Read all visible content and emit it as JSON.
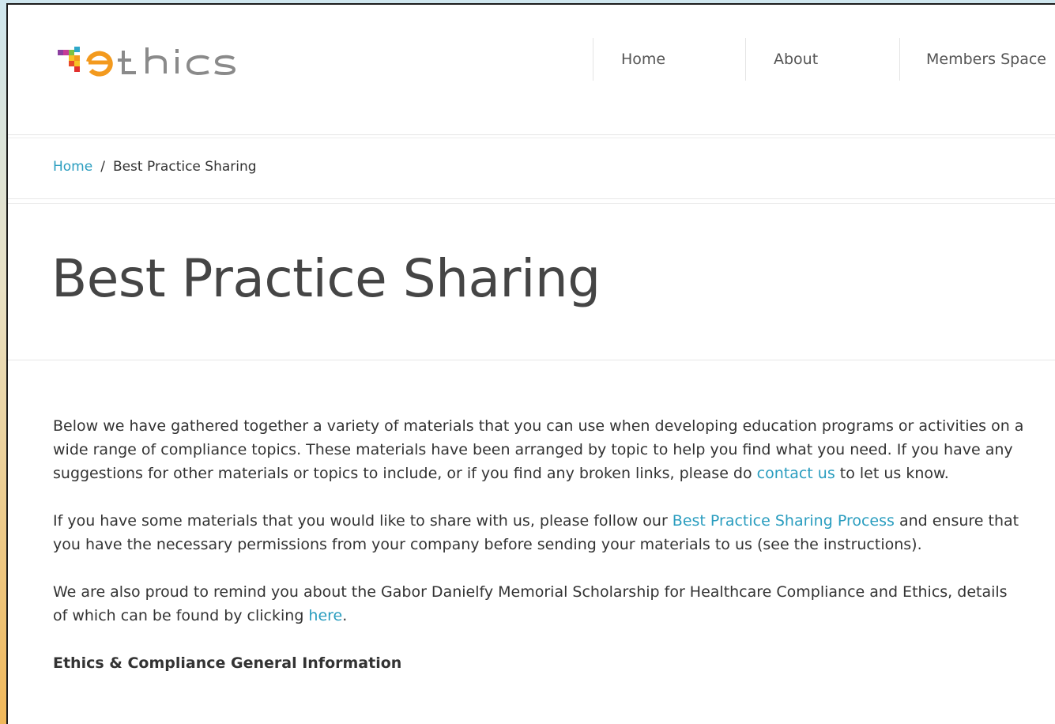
{
  "header": {
    "logo_text": "ethics",
    "nav": [
      {
        "label": "Home"
      },
      {
        "label": "About"
      },
      {
        "label": "Members Space"
      }
    ]
  },
  "breadcrumb": {
    "home": "Home",
    "separator": "/",
    "current": "Best Practice Sharing"
  },
  "page_title": "Best Practice Sharing",
  "content": {
    "p1_before": "Below we have gathered together a variety of materials that you can use when developing education programs or activities on a wide range of compliance topics.  These materials have been arranged by topic to help you find what you need.  If you have any suggestions for other materials or topics to include, or if you find any broken links, please do ",
    "p1_link": "contact us",
    "p1_after": " to let us know.",
    "p2_before": "If you have some materials that you would like to share with us, please follow our ",
    "p2_link": "Best Practice Sharing Process",
    "p2_after": " and ensure that you have the necessary permissions from your company before sending your materials to us (see the instructions).",
    "p3_before": "We are also proud to remind you about the Gabor Danielfy Memorial Scholarship for Healthcare Compliance and Ethics, details of which can be found by clicking ",
    "p3_link": "here",
    "p3_after": ".",
    "section_heading": "Ethics & Compliance General Information"
  },
  "colors": {
    "link": "#2a9dbf",
    "text": "#333333",
    "logo_orange": "#f39a1e",
    "logo_gray": "#8a8a8a"
  }
}
